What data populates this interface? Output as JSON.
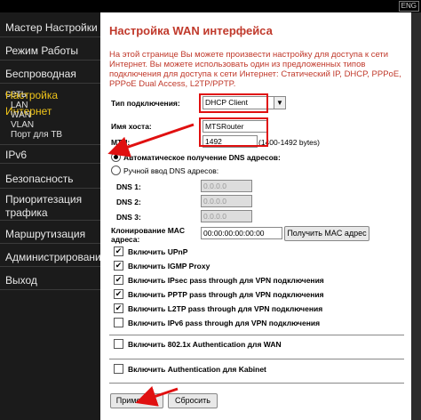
{
  "lang_button": "ENG",
  "sidebar": {
    "items": [
      {
        "label": "Мастер Настройки"
      },
      {
        "label": "Режим Работы"
      },
      {
        "label": "Беспроводная сеть"
      },
      {
        "label": "Настройка Интернет"
      },
      {
        "label": "IPv6"
      },
      {
        "label": "Безопасность"
      },
      {
        "label": "Приоритезация трафика"
      },
      {
        "label": "Маршрутизация"
      },
      {
        "label": "Администрирование"
      },
      {
        "label": "Выход"
      }
    ],
    "subitems": [
      {
        "label": "LAN"
      },
      {
        "label": "WAN"
      },
      {
        "label": "VLAN"
      },
      {
        "label": "Порт для ТВ"
      }
    ],
    "active_color": "#f0c419"
  },
  "main": {
    "title": "Настройка WAN интерфейса",
    "description": "На этой странице Вы можете произвести настройку для доступа к сети Интернет. Вы можете использовать один из предложенных типов подключения для доступа к сети Интернет: Статический IP, DHCP, PPPoE, PPPoE Dual Access, L2TP/PPTP.",
    "connection_type": {
      "label": "Тип подключения:",
      "value": "DHCP Client",
      "arrow": "▼"
    },
    "hostname": {
      "label": "Имя хоста:",
      "value": "MTSRouter"
    },
    "mtu": {
      "label": "MTU:",
      "value": "1492",
      "hint": "(1400-1492 bytes)"
    },
    "dns_auto": {
      "label": "Автоматическое получение DNS адресов:"
    },
    "dns_manual": {
      "label": "Ручной ввод DNS адресов:"
    },
    "dns": [
      {
        "label": "DNS 1:",
        "value": "0.0.0.0"
      },
      {
        "label": "DNS 2:",
        "value": "0.0.0.0"
      },
      {
        "label": "DNS 3:",
        "value": "0.0.0.0"
      }
    ],
    "mac": {
      "label_line1": "Клонирование MAC",
      "label_line2": "адреса:",
      "value": "00:00:00:00:00:00",
      "button": "Получить MAC адрес"
    },
    "checkboxes": [
      {
        "label": "Включить UPnP",
        "checked": true
      },
      {
        "label": "Включить IGMP Proxy",
        "checked": true
      },
      {
        "label": "Включить IPsec pass through для VPN подключения",
        "checked": true
      },
      {
        "label": "Включить PPTP pass through для VPN подключения",
        "checked": true
      },
      {
        "label": "Включить L2TP pass through для VPN подключения",
        "checked": true
      },
      {
        "label": "Включить IPv6 pass through для VPN подключения",
        "checked": false
      }
    ],
    "auth_wan": {
      "label": "Включить 802.1x Authentication для WAN",
      "checked": false
    },
    "auth_kabinet": {
      "label": "Включить Authentication для Kabinet",
      "checked": false
    },
    "apply_button": "Применить",
    "reset_button": "Сбросить",
    "check_mark": "✔",
    "accent_color": "#c0392b",
    "annotation_color": "#e01010"
  }
}
